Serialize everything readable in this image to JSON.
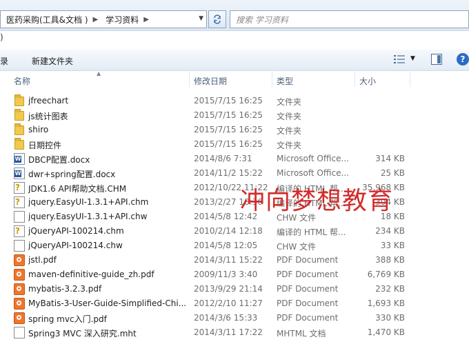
{
  "address": {
    "crumbs": [
      "医药采购(工具&文档 )",
      "学习资料"
    ],
    "search_placeholder": "搜索 学习资料"
  },
  "menu_stub": ")",
  "toolbar": {
    "left_partial": "组录",
    "new_folder": "新建文件夹"
  },
  "columns": {
    "name": "名称",
    "date": "修改日期",
    "type": "类型",
    "size": "大小"
  },
  "files": [
    {
      "name": "jfreechart",
      "date": "2015/7/15 16:25",
      "type": "文件夹",
      "size": "",
      "icon": "folder-icon"
    },
    {
      "name": "js统计图表",
      "date": "2015/7/15 16:25",
      "type": "文件夹",
      "size": "",
      "icon": "folder-icon"
    },
    {
      "name": "shiro",
      "date": "2015/7/15 16:25",
      "type": "文件夹",
      "size": "",
      "icon": "folder-icon"
    },
    {
      "name": "日期控件",
      "date": "2015/7/15 16:25",
      "type": "文件夹",
      "size": "",
      "icon": "folder-icon"
    },
    {
      "name": "DBCP配置.docx",
      "date": "2014/8/6 7:31",
      "type": "Microsoft Office...",
      "size": "314 KB",
      "icon": "word-doc-icon"
    },
    {
      "name": "dwr+spring配置.docx",
      "date": "2014/11/2 15:22",
      "type": "Microsoft Office...",
      "size": "25 KB",
      "icon": "word-doc-icon"
    },
    {
      "name": "JDK1.6 API帮助文档.CHM",
      "date": "2012/10/22 11:22",
      "type": "编译的 HTML 帮...",
      "size": "35,968 KB",
      "icon": "chm-help-icon"
    },
    {
      "name": "jquery.EasyUI-1.3.1+API.chm",
      "date": "2013/2/27 18:36",
      "type": "编译的 HTML 帮...",
      "size": "304 KB",
      "icon": "chm-help-icon"
    },
    {
      "name": "jquery.EasyUI-1.3.1+API.chw",
      "date": "2014/5/8 12:42",
      "type": "CHW 文件",
      "size": "18 KB",
      "icon": "blank-file-icon"
    },
    {
      "name": "jQueryAPI-100214.chm",
      "date": "2010/2/14 12:18",
      "type": "编译的 HTML 帮...",
      "size": "234 KB",
      "icon": "chm-help-icon"
    },
    {
      "name": "jQueryAPI-100214.chw",
      "date": "2014/5/8 12:05",
      "type": "CHW 文件",
      "size": "33 KB",
      "icon": "blank-file-icon"
    },
    {
      "name": "jstl.pdf",
      "date": "2014/3/11 15:22",
      "type": "PDF Document",
      "size": "388 KB",
      "icon": "pdf-icon"
    },
    {
      "name": "maven-definitive-guide_zh.pdf",
      "date": "2009/11/3 3:40",
      "type": "PDF Document",
      "size": "6,769 KB",
      "icon": "pdf-icon"
    },
    {
      "name": "mybatis-3.2.3.pdf",
      "date": "2013/9/29 21:14",
      "type": "PDF Document",
      "size": "232 KB",
      "icon": "pdf-icon"
    },
    {
      "name": "MyBatis-3-User-Guide-Simplified-Chi...",
      "date": "2012/2/10 11:27",
      "type": "PDF Document",
      "size": "1,693 KB",
      "icon": "pdf-icon"
    },
    {
      "name": "spring mvc入门.pdf",
      "date": "2014/3/6 15:33",
      "type": "PDF Document",
      "size": "330 KB",
      "icon": "pdf-icon"
    },
    {
      "name": "Spring3 MVC 深入研究.mht",
      "date": "2014/3/11 17:22",
      "type": "MHTML 文档",
      "size": "1,470 KB",
      "icon": "blank-file-icon"
    }
  ],
  "watermark": "冲向梦想教育",
  "colors": {
    "watermark": "#d01b1b",
    "toolbar_bg": "#e3ecf6",
    "folder": "#f0c94f",
    "pdf": "#f0762c",
    "word": "#2a5699"
  }
}
